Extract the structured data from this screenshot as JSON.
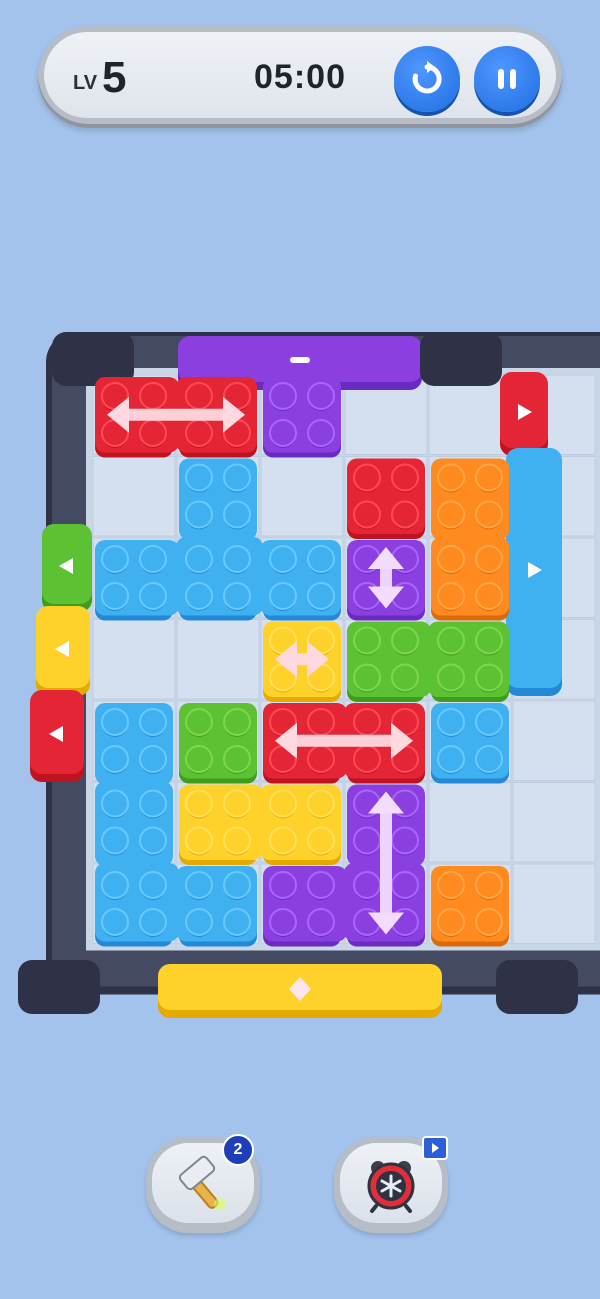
{
  "hud": {
    "level_prefix": "LV",
    "level_number": "5",
    "timer": "05:00",
    "restart_icon": "restart-icon",
    "pause_icon": "pause-icon"
  },
  "boosters": {
    "hammer": {
      "icon": "hammer-icon",
      "count": "2"
    },
    "freeze": {
      "icon": "freeze-clock-icon",
      "badge_icon": "video-ad-icon"
    }
  },
  "colors": {
    "background": "#a3c3ec",
    "red": "#e42535",
    "purple": "#8b3fe0",
    "blue": "#3fb0f0",
    "orange": "#ff8a1f",
    "green": "#5cc234",
    "yellow": "#ffd12a",
    "frame": "#2f3246"
  },
  "grid": {
    "columns": 6,
    "rows": 7
  },
  "blocks": [
    {
      "id": "red-top",
      "color": "red",
      "cells": [
        [
          0,
          0
        ],
        [
          1,
          0
        ]
      ],
      "arrow": "horizontal"
    },
    {
      "id": "purple-top",
      "color": "purple",
      "cells": [
        [
          2,
          0
        ]
      ],
      "arrow": "none"
    },
    {
      "id": "blue-t",
      "color": "blue",
      "cells": [
        [
          1,
          1
        ],
        [
          0,
          2
        ],
        [
          1,
          2
        ],
        [
          2,
          2
        ]
      ],
      "arrow": "none"
    },
    {
      "id": "red-small",
      "color": "red",
      "cells": [
        [
          3,
          1
        ]
      ],
      "arrow": "none"
    },
    {
      "id": "orange-tall",
      "color": "orange",
      "cells": [
        [
          4,
          1
        ],
        [
          4,
          2
        ]
      ],
      "arrow": "none"
    },
    {
      "id": "purple-small",
      "color": "purple",
      "cells": [
        [
          3,
          2
        ]
      ],
      "arrow": "vertical"
    },
    {
      "id": "yellow-small",
      "color": "yellow",
      "cells": [
        [
          2,
          3
        ]
      ],
      "arrow": "horizontal"
    },
    {
      "id": "green-long",
      "color": "green",
      "cells": [
        [
          3,
          3
        ],
        [
          4,
          3
        ]
      ],
      "arrow": "none"
    },
    {
      "id": "blue-l",
      "color": "blue",
      "cells": [
        [
          0,
          4
        ],
        [
          0,
          5
        ],
        [
          0,
          6
        ],
        [
          1,
          6
        ]
      ],
      "arrow": "none"
    },
    {
      "id": "green-small",
      "color": "green",
      "cells": [
        [
          1,
          4
        ]
      ],
      "arrow": "none"
    },
    {
      "id": "red-mid",
      "color": "red",
      "cells": [
        [
          2,
          4
        ],
        [
          3,
          4
        ]
      ],
      "arrow": "horizontal"
    },
    {
      "id": "blue-small",
      "color": "blue",
      "cells": [
        [
          4,
          4
        ]
      ],
      "arrow": "none"
    },
    {
      "id": "yellow-wide",
      "color": "yellow",
      "cells": [
        [
          1,
          5
        ],
        [
          2,
          5
        ]
      ],
      "arrow": "none"
    },
    {
      "id": "purple-j",
      "color": "purple",
      "cells": [
        [
          3,
          5
        ],
        [
          2,
          6
        ],
        [
          3,
          6
        ]
      ],
      "arrow": "vertical"
    },
    {
      "id": "orange-small",
      "color": "orange",
      "cells": [
        [
          4,
          6
        ]
      ],
      "arrow": "none"
    }
  ],
  "gates": [
    {
      "id": "gate-top-purple",
      "color": "purple",
      "side": "top",
      "marker": "dash"
    },
    {
      "id": "gate-bottom-yellow",
      "color": "yellow",
      "side": "bottom",
      "marker": "diamond"
    },
    {
      "id": "gate-right-red",
      "color": "red",
      "side": "right",
      "marker": "arrow-right"
    },
    {
      "id": "gate-right-blue",
      "color": "blue",
      "side": "right",
      "marker": "arrow-right"
    },
    {
      "id": "gate-left-green",
      "color": "green",
      "side": "left",
      "marker": "arrow-left"
    },
    {
      "id": "gate-left-yellow",
      "color": "yellow",
      "side": "left",
      "marker": "arrow-left"
    },
    {
      "id": "gate-left-red",
      "color": "red",
      "side": "left",
      "marker": "arrow-left"
    }
  ]
}
